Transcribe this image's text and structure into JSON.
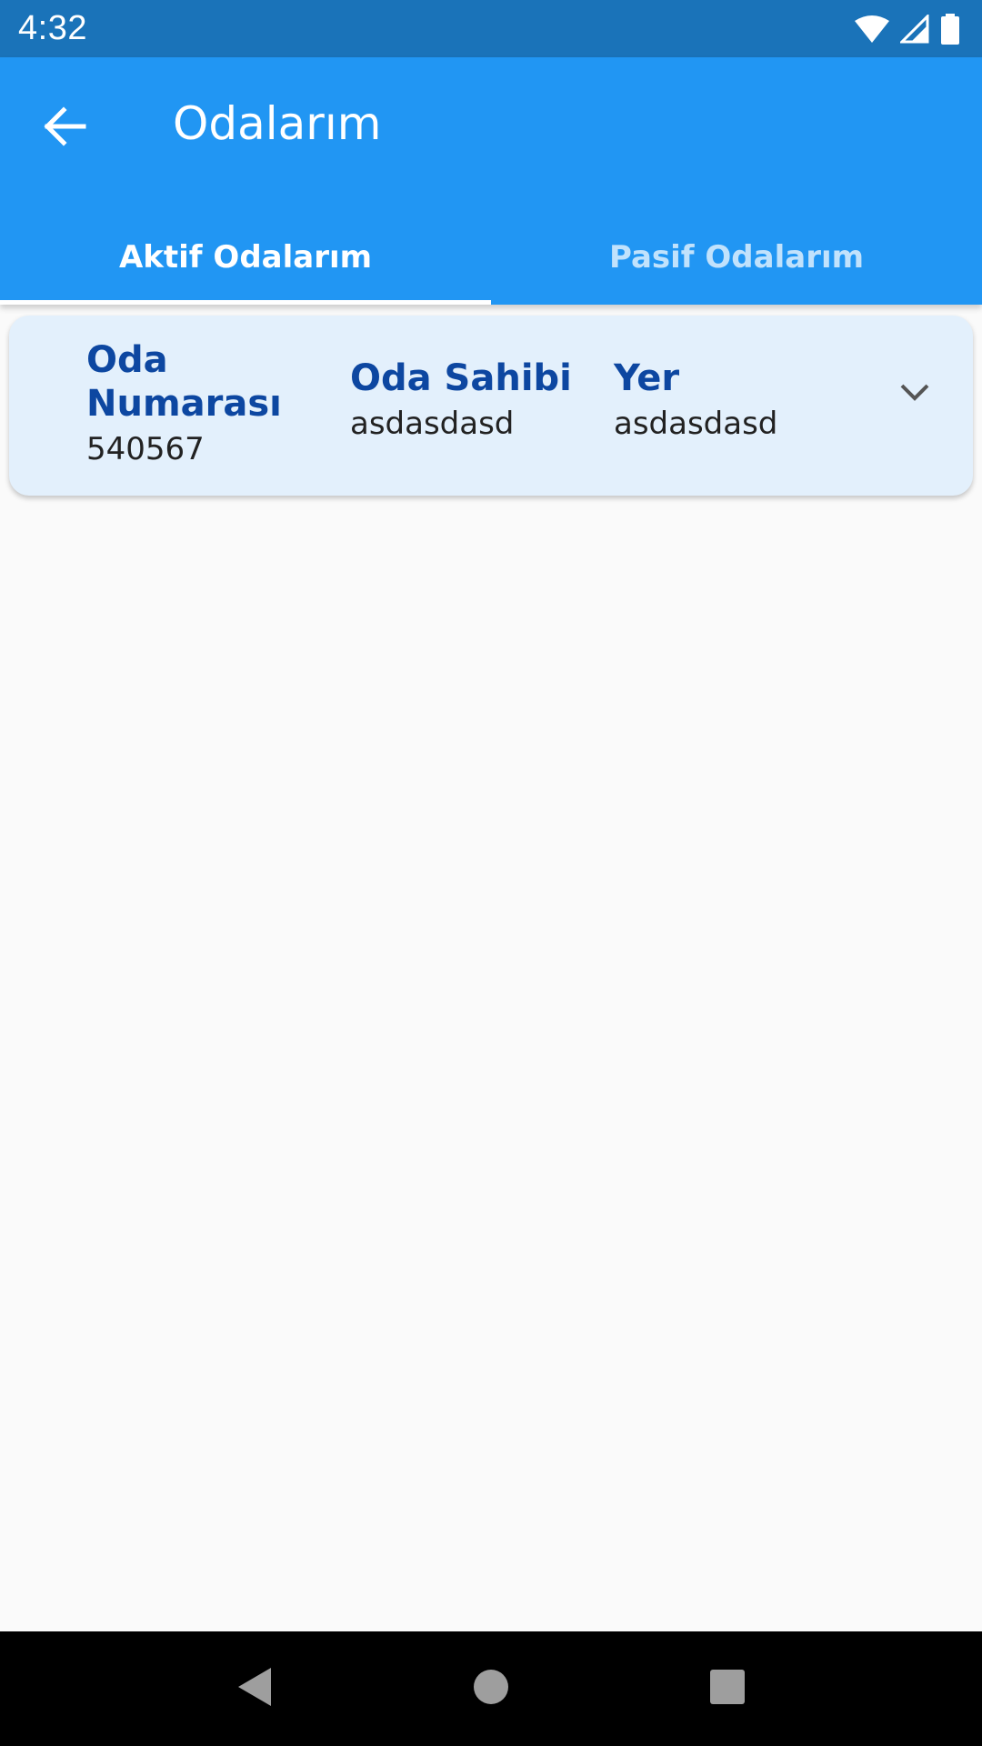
{
  "status_bar": {
    "time": "4:32",
    "icons": [
      "wifi-icon",
      "cell-signal-icon",
      "battery-icon"
    ]
  },
  "app_bar": {
    "title": "Odalarım",
    "back_icon": "arrow-back-icon"
  },
  "tabs": [
    {
      "label": "Aktif Odalarım",
      "active": true
    },
    {
      "label": "Pasif Odalarım",
      "active": false
    }
  ],
  "rooms": [
    {
      "room_number_label": "Oda Numarası",
      "room_number": "540567",
      "owner_label": "Oda Sahibi",
      "owner": "asdasdasd",
      "place_label": "Yer",
      "place": "asdasdasd",
      "expand_icon": "chevron-down-icon"
    }
  ],
  "nav_bar": {
    "buttons": [
      "back-triangle-icon",
      "home-circle-icon",
      "recents-square-icon"
    ]
  },
  "colors": {
    "status_bar": "#1a73b9",
    "app_bar": "#2196f3",
    "card_bg": "#e3f0fc",
    "label": "#0d47a1",
    "page_bg": "#fafafa"
  }
}
